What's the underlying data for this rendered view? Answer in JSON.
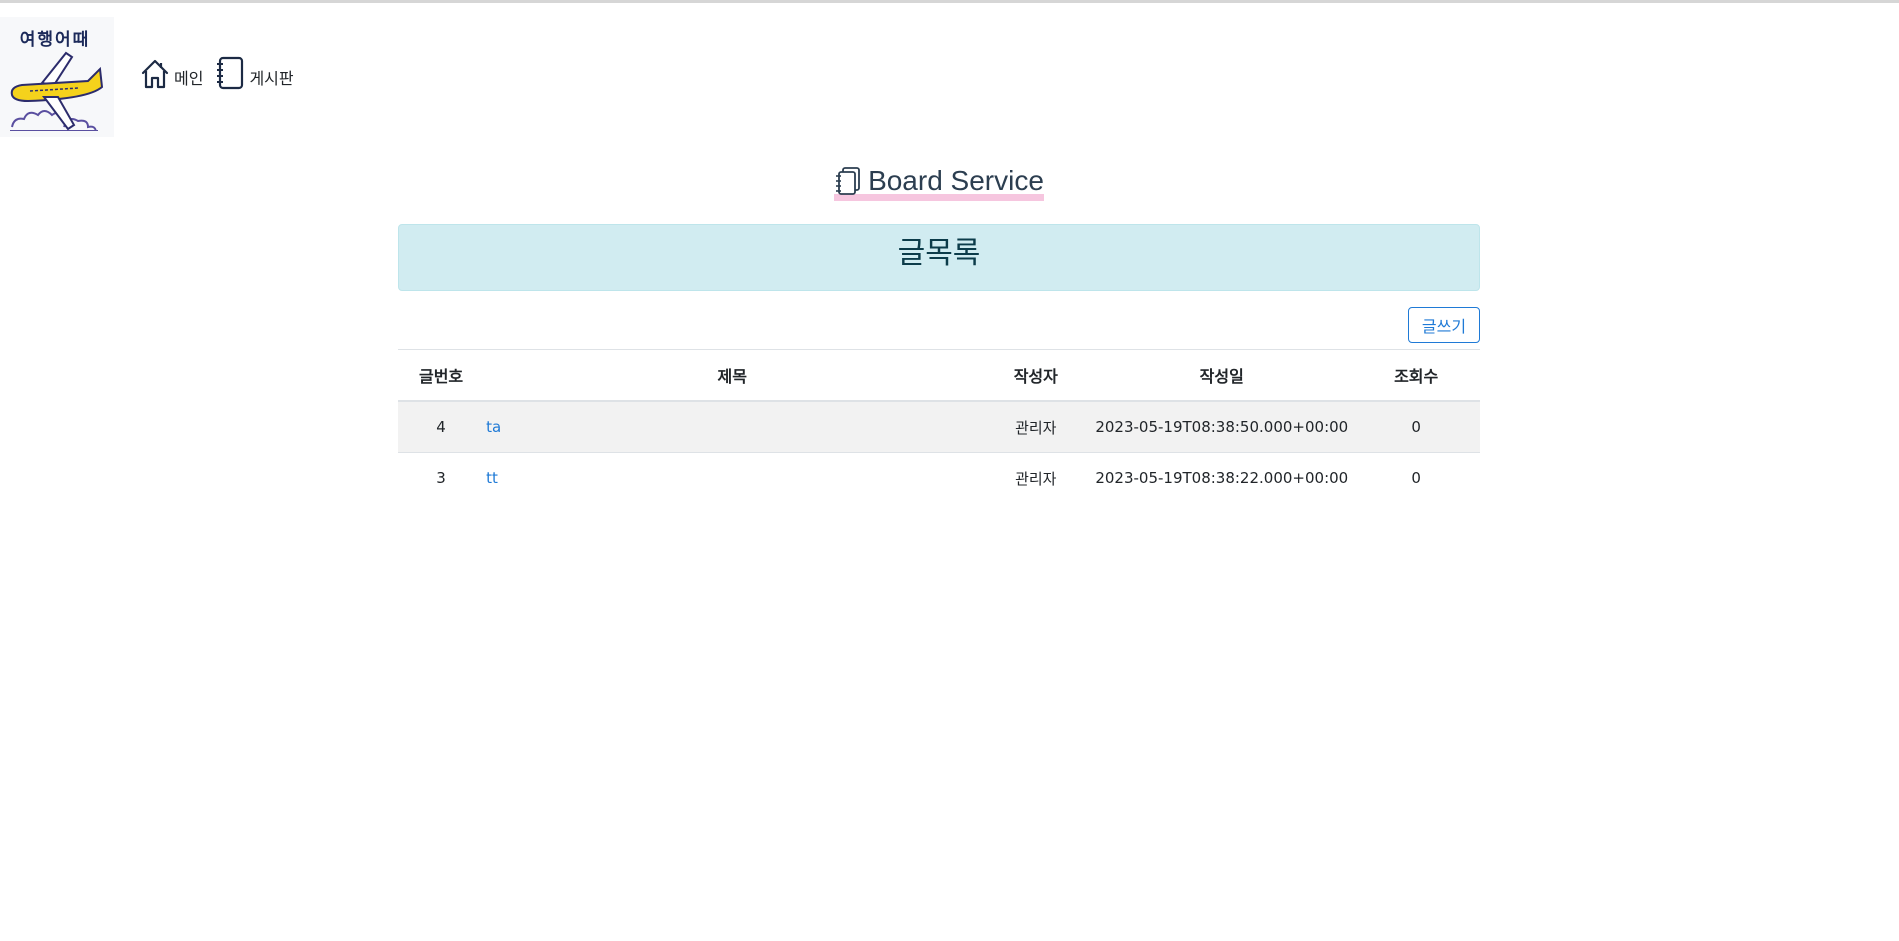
{
  "logo": {
    "text": "여행어때"
  },
  "nav": [
    {
      "label": "메인",
      "icon": "home-icon"
    },
    {
      "label": "게시판",
      "icon": "notebook-icon"
    }
  ],
  "page": {
    "title": "Board Service",
    "icon": "notebook-stack-icon"
  },
  "banner": {
    "title": "글목록"
  },
  "toolbar": {
    "write_label": "글쓰기"
  },
  "table": {
    "headers": [
      "글번호",
      "제목",
      "작성자",
      "작성일",
      "조회수"
    ],
    "rows": [
      {
        "no": "4",
        "title": "ta",
        "writer": "관리자",
        "date": "2023-05-19T08:38:50.000+00:00",
        "views": "0"
      },
      {
        "no": "3",
        "title": "tt",
        "writer": "관리자",
        "date": "2023-05-19T08:38:22.000+00:00",
        "views": "0"
      }
    ]
  },
  "colors": {
    "accent": "#1f7ad6",
    "banner_bg": "#d1ecf1",
    "title_highlight": "#f4bcd9",
    "logo_plane": "#f5d21c"
  }
}
